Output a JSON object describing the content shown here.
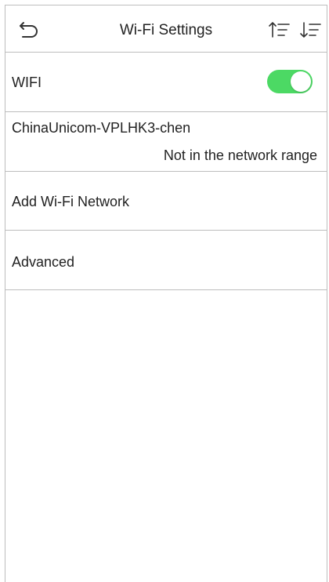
{
  "header": {
    "title": "Wi-Fi Settings",
    "back_icon": "back-arrow-icon",
    "sort_asc_icon": "sort-ascending-icon",
    "sort_desc_icon": "sort-descending-icon"
  },
  "wifi": {
    "label": "WIFI",
    "enabled": true,
    "toggle_color": "#4cd964"
  },
  "network": {
    "name": "ChinaUnicom-VPLHK3-chen",
    "status": "Not in the network range"
  },
  "add_network": {
    "label": "Add Wi-Fi Network"
  },
  "advanced": {
    "label": "Advanced"
  }
}
